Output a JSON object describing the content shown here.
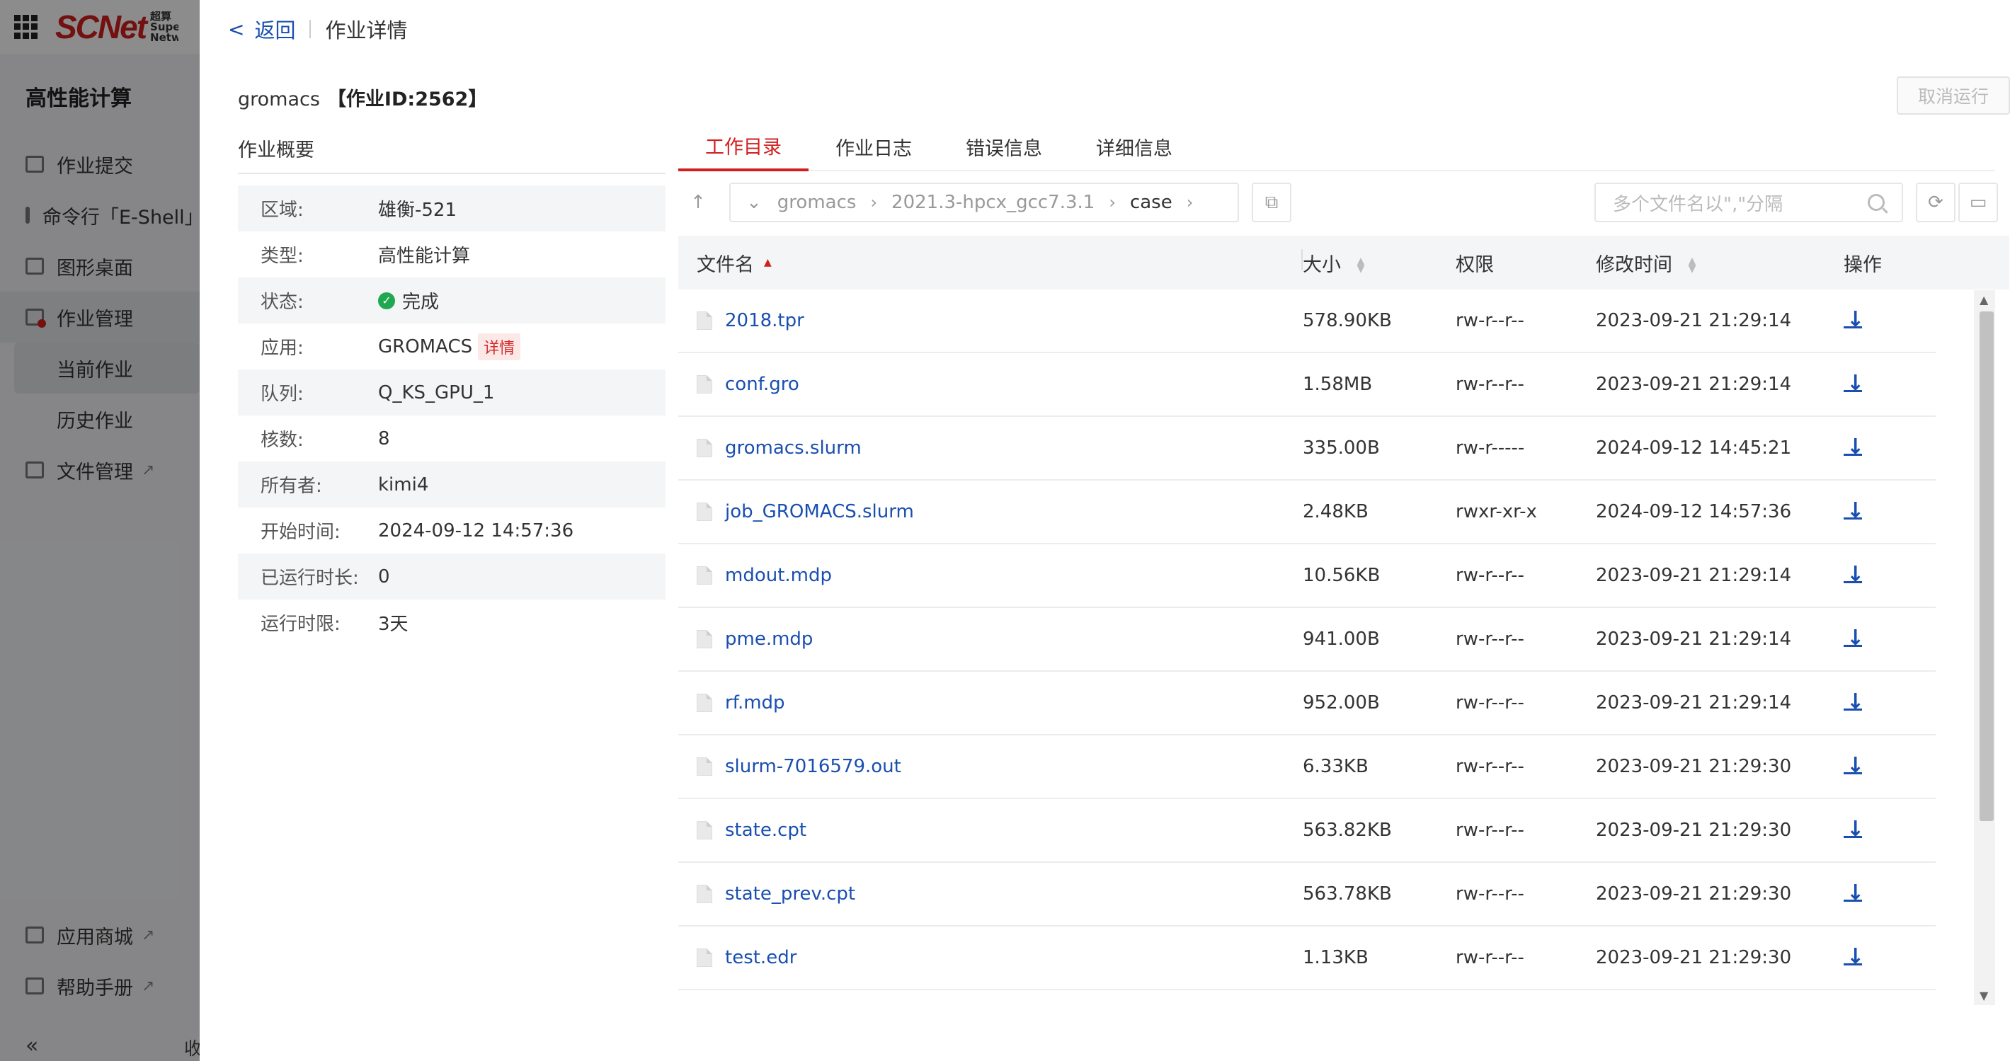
{
  "sidebar": {
    "logo": "SCNet",
    "logo_sub": "超算 SuperComputing Network",
    "title": "高性能计算",
    "items": [
      {
        "label": "作业提交"
      },
      {
        "label": "命令行「E-Shell」"
      },
      {
        "label": "图形桌面"
      },
      {
        "label": "作业管理"
      }
    ],
    "sub_items": [
      {
        "label": "当前作业"
      },
      {
        "label": "历史作业"
      }
    ],
    "file_mgmt": "文件管理",
    "app_store": "应用商城",
    "help": "帮助手册",
    "collapse_icon": "«",
    "collapse_text": "收"
  },
  "header": {
    "back": "返回",
    "title": "作业详情"
  },
  "job": {
    "name": "gromacs",
    "id_label": "【作业ID:2562】",
    "cancel": "取消运行"
  },
  "overview": {
    "title": "作业概要",
    "rows": [
      {
        "label": "区域:",
        "value": "雄衡-521"
      },
      {
        "label": "类型:",
        "value": "高性能计算"
      },
      {
        "label": "状态:",
        "value": "完成"
      },
      {
        "label": "应用:",
        "value": "GROMACS",
        "tag": "详情"
      },
      {
        "label": "队列:",
        "value": "Q_KS_GPU_1"
      },
      {
        "label": "核数:",
        "value": "8"
      },
      {
        "label": "所有者:",
        "value": "kimi4"
      },
      {
        "label": "开始时间:",
        "value": "2024-09-12 14:57:36"
      },
      {
        "label": "已运行时长:",
        "value": "0"
      },
      {
        "label": "运行时限:",
        "value": "3天"
      }
    ]
  },
  "tabs": [
    "工作目录",
    "作业日志",
    "错误信息",
    "详细信息"
  ],
  "toolbar": {
    "path": [
      "gromacs",
      "2021.3-hpcx_gcc7.3.1",
      "case"
    ],
    "search_placeholder": "多个文件名以\",\"分隔"
  },
  "table": {
    "headers": {
      "name": "文件名",
      "size": "大小",
      "perm": "权限",
      "time": "修改时间",
      "op": "操作"
    },
    "rows": [
      {
        "name": "2018.tpr",
        "size": "578.90KB",
        "perm": "rw-r--r--",
        "time": "2023-09-21 21:29:14"
      },
      {
        "name": "conf.gro",
        "size": "1.58MB",
        "perm": "rw-r--r--",
        "time": "2023-09-21 21:29:14"
      },
      {
        "name": "gromacs.slurm",
        "size": "335.00B",
        "perm": "rw-r-----",
        "time": "2024-09-12 14:45:21"
      },
      {
        "name": "job_GROMACS.slurm",
        "size": "2.48KB",
        "perm": "rwxr-xr-x",
        "time": "2024-09-12 14:57:36"
      },
      {
        "name": "mdout.mdp",
        "size": "10.56KB",
        "perm": "rw-r--r--",
        "time": "2023-09-21 21:29:14"
      },
      {
        "name": "pme.mdp",
        "size": "941.00B",
        "perm": "rw-r--r--",
        "time": "2023-09-21 21:29:14"
      },
      {
        "name": "rf.mdp",
        "size": "952.00B",
        "perm": "rw-r--r--",
        "time": "2023-09-21 21:29:14"
      },
      {
        "name": "slurm-7016579.out",
        "size": "6.33KB",
        "perm": "rw-r--r--",
        "time": "2023-09-21 21:29:30"
      },
      {
        "name": "state.cpt",
        "size": "563.82KB",
        "perm": "rw-r--r--",
        "time": "2023-09-21 21:29:30"
      },
      {
        "name": "state_prev.cpt",
        "size": "563.78KB",
        "perm": "rw-r--r--",
        "time": "2023-09-21 21:29:30"
      },
      {
        "name": "test.edr",
        "size": "1.13KB",
        "perm": "rw-r--r--",
        "time": "2023-09-21 21:29:30"
      }
    ]
  },
  "colors": {
    "accent": "#d21e1e",
    "link": "#1a4fb0",
    "success": "#1fa84f"
  }
}
